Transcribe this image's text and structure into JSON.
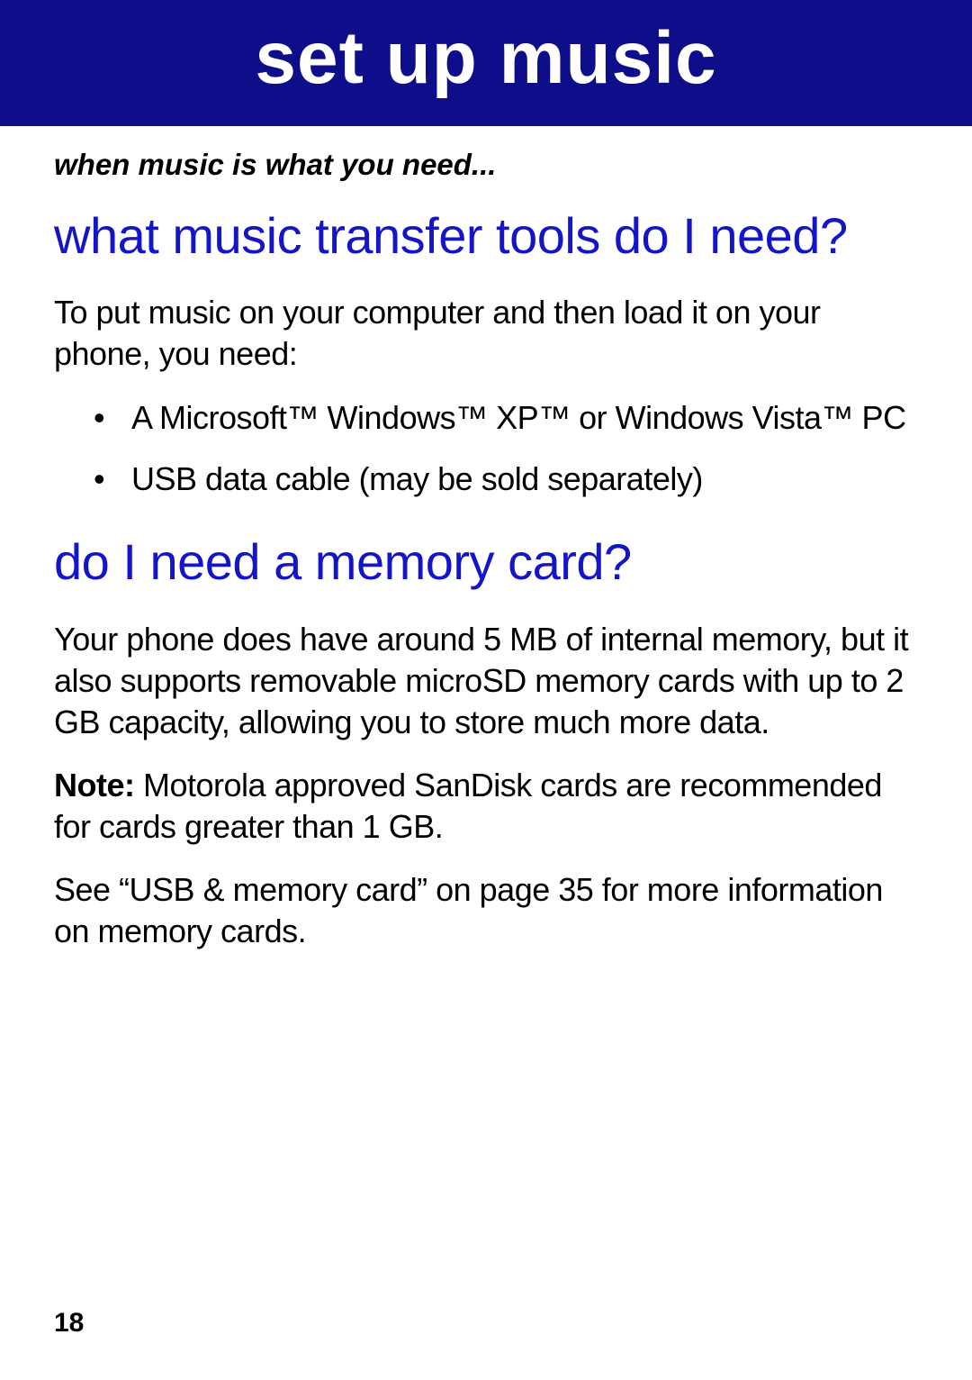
{
  "banner": {
    "title": "set up music"
  },
  "tagline": "when music is what you need...",
  "section1": {
    "heading": "what music transfer tools do I need?",
    "intro": "To put music on your computer and then load it on your phone, you need:",
    "bullets": [
      "A Microsoft™ Windows™ XP™ or Windows Vista™ PC",
      "USB data cable (may be sold separately)"
    ]
  },
  "section2": {
    "heading": "do I need a memory card?",
    "para1": "Your phone does have around 5 MB of internal memory, but it also supports removable microSD memory cards with up to 2 GB capacity, allowing you to store much more data.",
    "note_label": "Note: ",
    "note_text": "Motorola approved SanDisk cards are recommended for cards greater than 1 GB.",
    "para3": "See “USB & memory card” on page 35 for more information on memory cards."
  },
  "page_number": "18"
}
